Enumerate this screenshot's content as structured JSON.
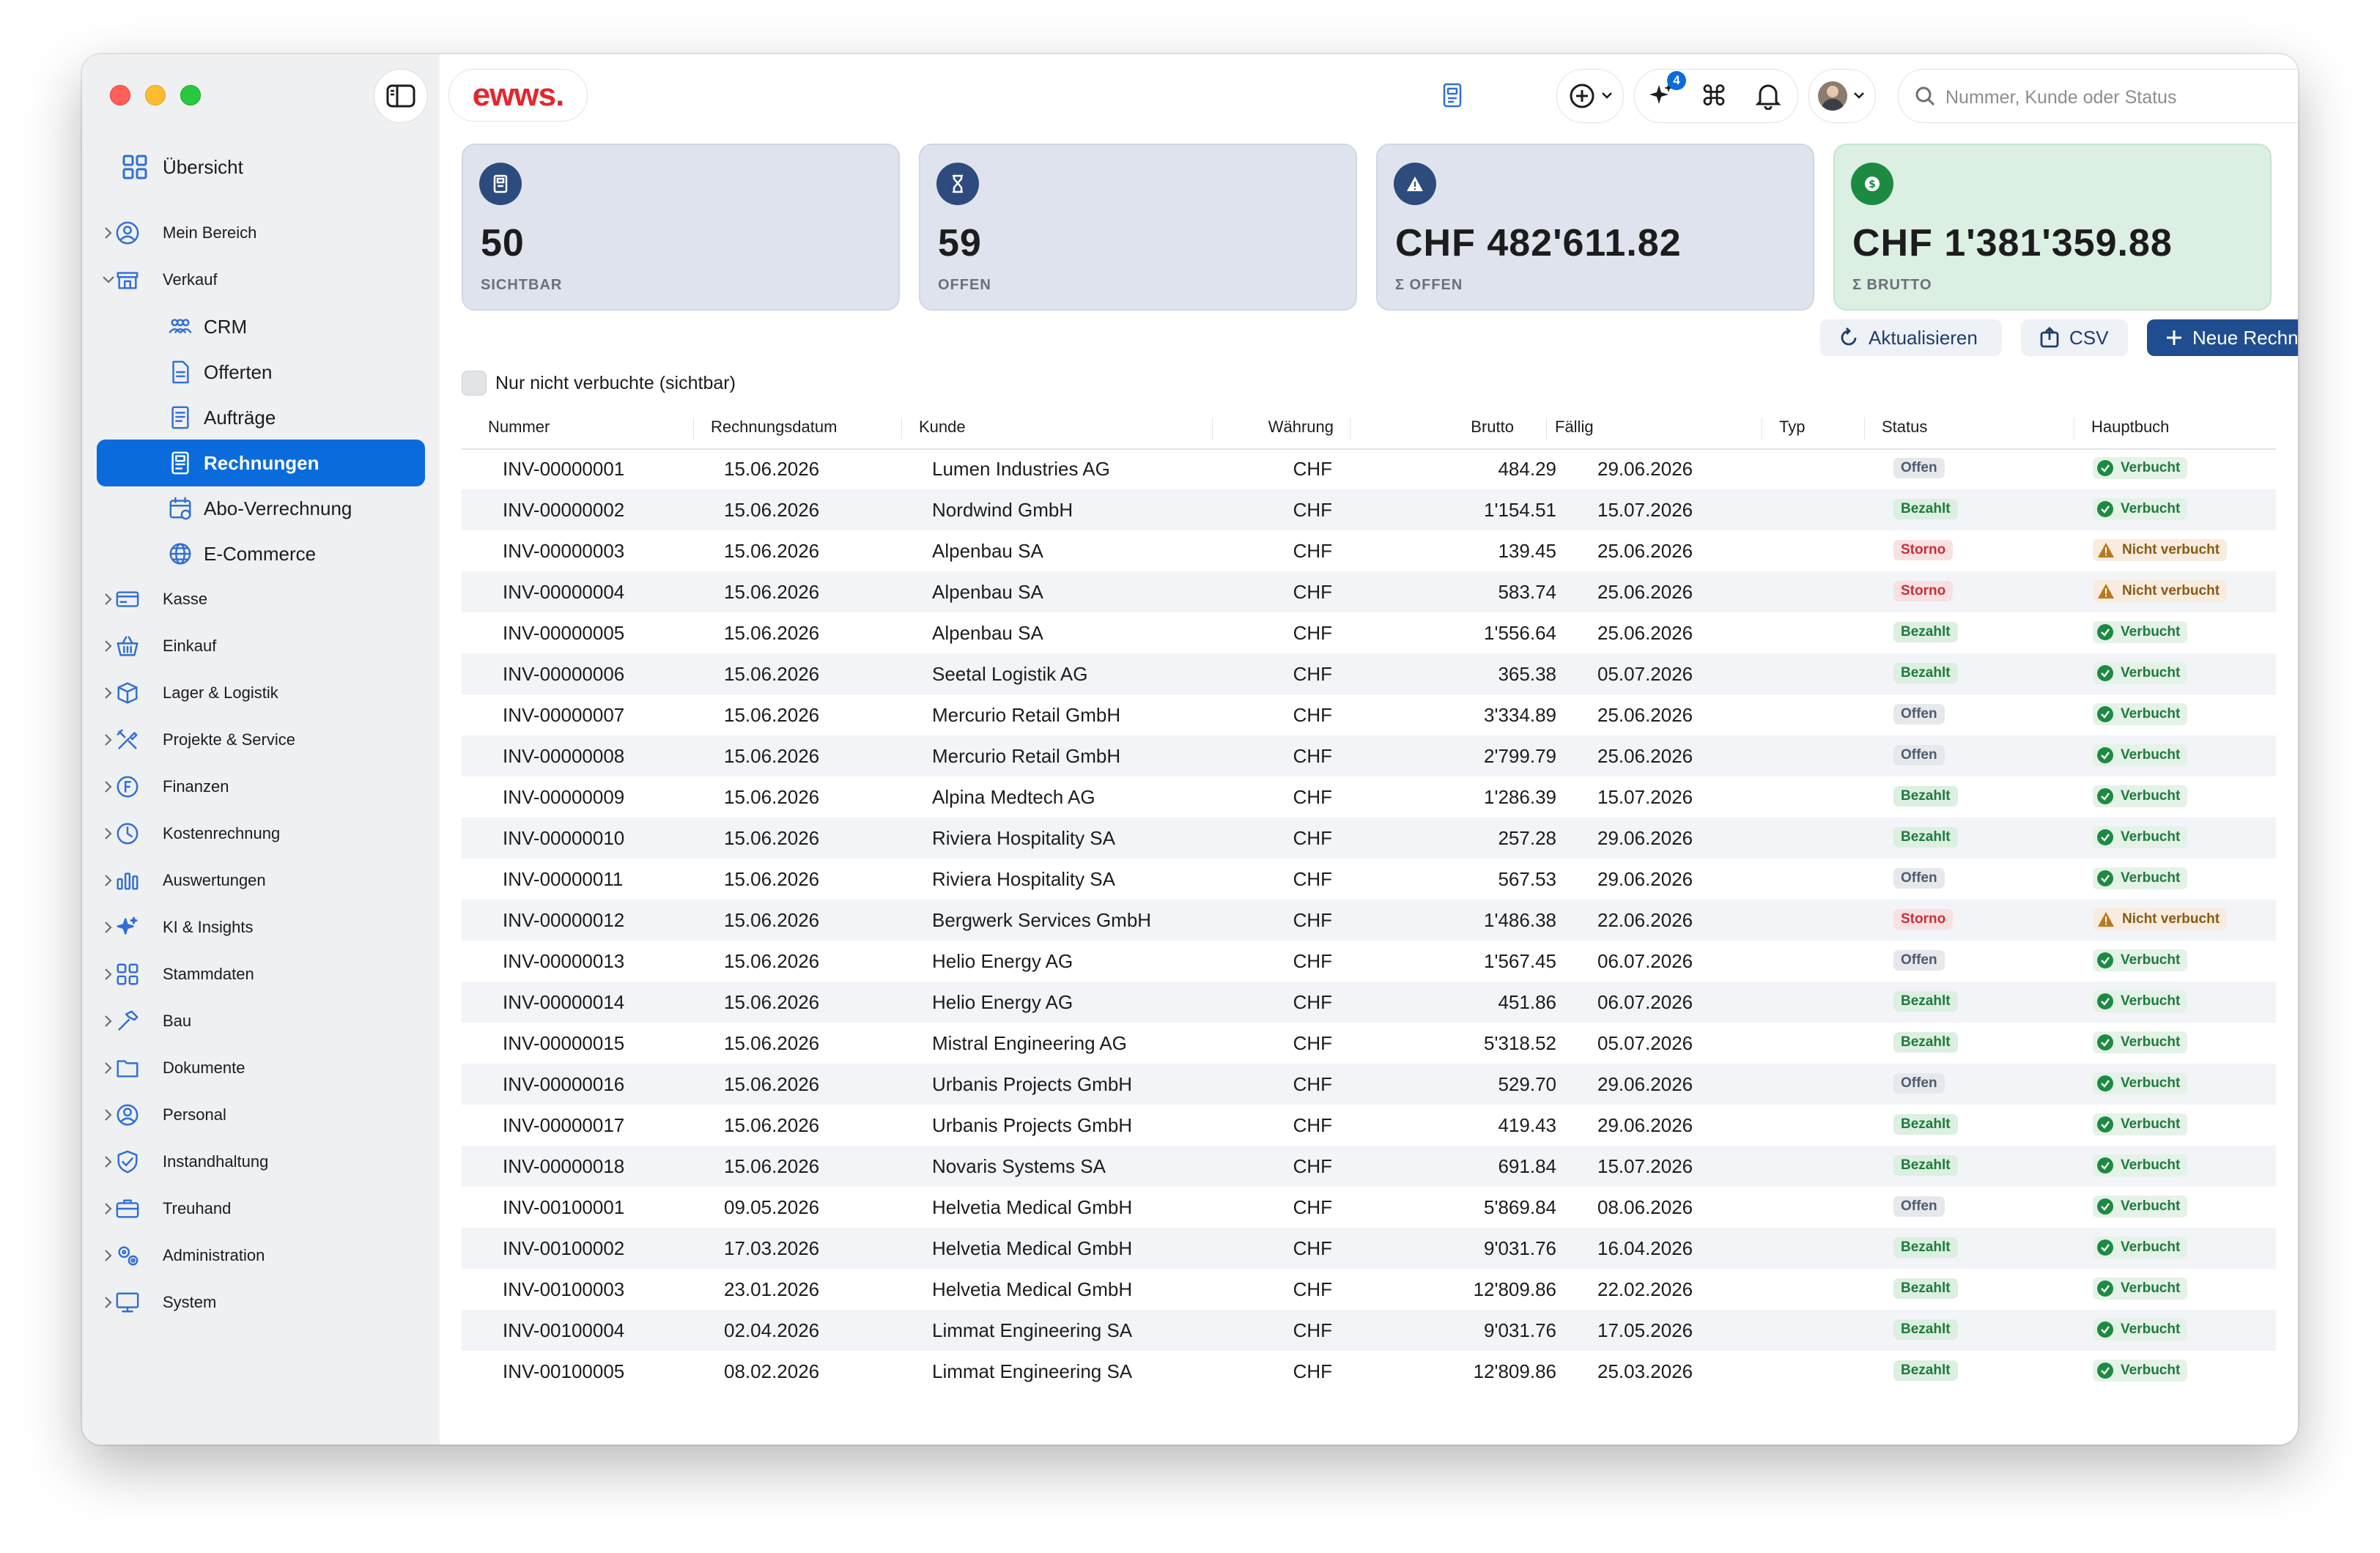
{
  "app": {
    "logo_text": "ewws."
  },
  "sidebar": {
    "overview": "Übersicht",
    "items": [
      {
        "label": "Mein Bereich",
        "icon": "user-circle-icon",
        "expanded": false
      },
      {
        "label": "Verkauf",
        "icon": "store-icon",
        "expanded": true
      },
      {
        "label": "CRM",
        "icon": "people-icon",
        "sub": true
      },
      {
        "label": "Offerten",
        "icon": "document-icon",
        "sub": true
      },
      {
        "label": "Aufträge",
        "icon": "list-document-icon",
        "sub": true
      },
      {
        "label": "Rechnungen",
        "icon": "invoice-icon",
        "sub": true,
        "active": true
      },
      {
        "label": "Abo-Verrechnung",
        "icon": "calendar-icon",
        "sub": true
      },
      {
        "label": "E-Commerce",
        "icon": "globe-icon",
        "sub": true
      },
      {
        "label": "Kasse",
        "icon": "credit-card-icon",
        "expanded": false
      },
      {
        "label": "Einkauf",
        "icon": "basket-icon",
        "expanded": false
      },
      {
        "label": "Lager & Logistik",
        "icon": "boxes-icon",
        "expanded": false
      },
      {
        "label": "Projekte & Service",
        "icon": "tools-icon",
        "expanded": false
      },
      {
        "label": "Finanzen",
        "icon": "finance-icon",
        "expanded": false
      },
      {
        "label": "Kostenrechnung",
        "icon": "clock-icon",
        "expanded": false
      },
      {
        "label": "Auswertungen",
        "icon": "bar-chart-icon",
        "expanded": false
      },
      {
        "label": "KI & Insights",
        "icon": "sparkle-icon",
        "expanded": false
      },
      {
        "label": "Stammdaten",
        "icon": "grid-icon",
        "expanded": false
      },
      {
        "label": "Bau",
        "icon": "hammer-icon",
        "expanded": false
      },
      {
        "label": "Dokumente",
        "icon": "folder-icon",
        "expanded": false
      },
      {
        "label": "Personal",
        "icon": "person-icon",
        "expanded": false
      },
      {
        "label": "Instandhaltung",
        "icon": "shield-check-icon",
        "expanded": false
      },
      {
        "label": "Treuhand",
        "icon": "briefcase-icon",
        "expanded": false
      },
      {
        "label": "Administration",
        "icon": "gears-icon",
        "expanded": false
      },
      {
        "label": "System",
        "icon": "monitor-icon",
        "expanded": false
      }
    ]
  },
  "topbar": {
    "search_placeholder": "Nummer, Kunde oder Status",
    "notification_count": "4"
  },
  "stats": [
    {
      "value": "50",
      "label": "SICHTBAR",
      "icon": "document-icon"
    },
    {
      "value": "59",
      "label": "OFFEN",
      "icon": "hourglass-icon"
    },
    {
      "value": "CHF 482'611.82",
      "label": "Σ OFFEN",
      "icon": "warning-icon"
    },
    {
      "value": "CHF 1'381'359.88",
      "label": "Σ BRUTTO",
      "icon": "money-icon"
    }
  ],
  "actions": {
    "refresh": "Aktualisieren",
    "csv": "CSV",
    "new_invoice": "Neue Rechnung"
  },
  "filter": {
    "label": "Nur nicht verbuchte (sichtbar)",
    "checked": false
  },
  "table": {
    "columns": [
      "Nummer",
      "Rechnungsdatum",
      "Kunde",
      "Währung",
      "Brutto",
      "Fällig",
      "Typ",
      "Status",
      "Hauptbuch"
    ],
    "rows": [
      {
        "nr": "INV-00000001",
        "datum": "15.06.2026",
        "kunde": "Lumen Industries AG",
        "waehrung": "CHF",
        "brutto": "484.29",
        "faellig": "29.06.2026",
        "typ": "",
        "status": "Offen",
        "hauptbuch": "Verbucht"
      },
      {
        "nr": "INV-00000002",
        "datum": "15.06.2026",
        "kunde": "Nordwind GmbH",
        "waehrung": "CHF",
        "brutto": "1'154.51",
        "faellig": "15.07.2026",
        "typ": "",
        "status": "Bezahlt",
        "hauptbuch": "Verbucht"
      },
      {
        "nr": "INV-00000003",
        "datum": "15.06.2026",
        "kunde": "Alpenbau SA",
        "waehrung": "CHF",
        "brutto": "139.45",
        "faellig": "25.06.2026",
        "typ": "",
        "status": "Storno",
        "hauptbuch": "Nicht verbucht"
      },
      {
        "nr": "INV-00000004",
        "datum": "15.06.2026",
        "kunde": "Alpenbau SA",
        "waehrung": "CHF",
        "brutto": "583.74",
        "faellig": "25.06.2026",
        "typ": "",
        "status": "Storno",
        "hauptbuch": "Nicht verbucht"
      },
      {
        "nr": "INV-00000005",
        "datum": "15.06.2026",
        "kunde": "Alpenbau SA",
        "waehrung": "CHF",
        "brutto": "1'556.64",
        "faellig": "25.06.2026",
        "typ": "",
        "status": "Bezahlt",
        "hauptbuch": "Verbucht"
      },
      {
        "nr": "INV-00000006",
        "datum": "15.06.2026",
        "kunde": "Seetal Logistik AG",
        "waehrung": "CHF",
        "brutto": "365.38",
        "faellig": "05.07.2026",
        "typ": "",
        "status": "Bezahlt",
        "hauptbuch": "Verbucht"
      },
      {
        "nr": "INV-00000007",
        "datum": "15.06.2026",
        "kunde": "Mercurio Retail GmbH",
        "waehrung": "CHF",
        "brutto": "3'334.89",
        "faellig": "25.06.2026",
        "typ": "",
        "status": "Offen",
        "hauptbuch": "Verbucht"
      },
      {
        "nr": "INV-00000008",
        "datum": "15.06.2026",
        "kunde": "Mercurio Retail GmbH",
        "waehrung": "CHF",
        "brutto": "2'799.79",
        "faellig": "25.06.2026",
        "typ": "",
        "status": "Offen",
        "hauptbuch": "Verbucht"
      },
      {
        "nr": "INV-00000009",
        "datum": "15.06.2026",
        "kunde": "Alpina Medtech AG",
        "waehrung": "CHF",
        "brutto": "1'286.39",
        "faellig": "15.07.2026",
        "typ": "",
        "status": "Bezahlt",
        "hauptbuch": "Verbucht"
      },
      {
        "nr": "INV-00000010",
        "datum": "15.06.2026",
        "kunde": "Riviera Hospitality SA",
        "waehrung": "CHF",
        "brutto": "257.28",
        "faellig": "29.06.2026",
        "typ": "",
        "status": "Bezahlt",
        "hauptbuch": "Verbucht"
      },
      {
        "nr": "INV-00000011",
        "datum": "15.06.2026",
        "kunde": "Riviera Hospitality SA",
        "waehrung": "CHF",
        "brutto": "567.53",
        "faellig": "29.06.2026",
        "typ": "",
        "status": "Offen",
        "hauptbuch": "Verbucht"
      },
      {
        "nr": "INV-00000012",
        "datum": "15.06.2026",
        "kunde": "Bergwerk Services GmbH",
        "waehrung": "CHF",
        "brutto": "1'486.38",
        "faellig": "22.06.2026",
        "typ": "",
        "status": "Storno",
        "hauptbuch": "Nicht verbucht"
      },
      {
        "nr": "INV-00000013",
        "datum": "15.06.2026",
        "kunde": "Helio Energy AG",
        "waehrung": "CHF",
        "brutto": "1'567.45",
        "faellig": "06.07.2026",
        "typ": "",
        "status": "Offen",
        "hauptbuch": "Verbucht"
      },
      {
        "nr": "INV-00000014",
        "datum": "15.06.2026",
        "kunde": "Helio Energy AG",
        "waehrung": "CHF",
        "brutto": "451.86",
        "faellig": "06.07.2026",
        "typ": "",
        "status": "Bezahlt",
        "hauptbuch": "Verbucht"
      },
      {
        "nr": "INV-00000015",
        "datum": "15.06.2026",
        "kunde": "Mistral Engineering AG",
        "waehrung": "CHF",
        "brutto": "5'318.52",
        "faellig": "05.07.2026",
        "typ": "",
        "status": "Bezahlt",
        "hauptbuch": "Verbucht"
      },
      {
        "nr": "INV-00000016",
        "datum": "15.06.2026",
        "kunde": "Urbanis Projects GmbH",
        "waehrung": "CHF",
        "brutto": "529.70",
        "faellig": "29.06.2026",
        "typ": "",
        "status": "Offen",
        "hauptbuch": "Verbucht"
      },
      {
        "nr": "INV-00000017",
        "datum": "15.06.2026",
        "kunde": "Urbanis Projects GmbH",
        "waehrung": "CHF",
        "brutto": "419.43",
        "faellig": "29.06.2026",
        "typ": "",
        "status": "Bezahlt",
        "hauptbuch": "Verbucht"
      },
      {
        "nr": "INV-00000018",
        "datum": "15.06.2026",
        "kunde": "Novaris Systems SA",
        "waehrung": "CHF",
        "brutto": "691.84",
        "faellig": "15.07.2026",
        "typ": "",
        "status": "Bezahlt",
        "hauptbuch": "Verbucht"
      },
      {
        "nr": "INV-00100001",
        "datum": "09.05.2026",
        "kunde": "Helvetia Medical GmbH",
        "waehrung": "CHF",
        "brutto": "5'869.84",
        "faellig": "08.06.2026",
        "typ": "",
        "status": "Offen",
        "hauptbuch": "Verbucht"
      },
      {
        "nr": "INV-00100002",
        "datum": "17.03.2026",
        "kunde": "Helvetia Medical GmbH",
        "waehrung": "CHF",
        "brutto": "9'031.76",
        "faellig": "16.04.2026",
        "typ": "",
        "status": "Bezahlt",
        "hauptbuch": "Verbucht"
      },
      {
        "nr": "INV-00100003",
        "datum": "23.01.2026",
        "kunde": "Helvetia Medical GmbH",
        "waehrung": "CHF",
        "brutto": "12'809.86",
        "faellig": "22.02.2026",
        "typ": "",
        "status": "Bezahlt",
        "hauptbuch": "Verbucht"
      },
      {
        "nr": "INV-00100004",
        "datum": "02.04.2026",
        "kunde": "Limmat Engineering SA",
        "waehrung": "CHF",
        "brutto": "9'031.76",
        "faellig": "17.05.2026",
        "typ": "",
        "status": "Bezahlt",
        "hauptbuch": "Verbucht"
      },
      {
        "nr": "INV-00100005",
        "datum": "08.02.2026",
        "kunde": "Limmat Engineering SA",
        "waehrung": "CHF",
        "brutto": "12'809.86",
        "faellig": "25.03.2026",
        "typ": "",
        "status": "Bezahlt",
        "hauptbuch": "Verbucht"
      }
    ]
  },
  "colors": {
    "accent": "#0a6cdc",
    "primary_button": "#1f4d8f",
    "logo_red": "#e3262e",
    "status_paid": "#1f7a3c",
    "status_storno": "#c8303a"
  }
}
